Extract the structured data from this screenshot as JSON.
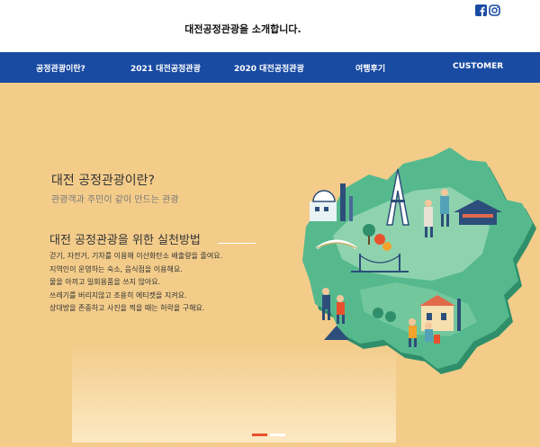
{
  "header": {
    "site_title": "대전공정관광을 소개합니다.",
    "social_icons": [
      "facebook-icon",
      "instagram-icon"
    ],
    "brand_color": "#1a4ba3"
  },
  "nav": {
    "items": [
      {
        "label": "공정관광이란?"
      },
      {
        "label": "2021 대전공정관광"
      },
      {
        "label": "2020 대전공정관광"
      },
      {
        "label": "여행후기"
      },
      {
        "label": "CUSTOMER"
      }
    ]
  },
  "hero": {
    "background_color": "#f3cc8a",
    "title": "대전 공정관광이란?",
    "subtitle": "관광객과 주민이 같이 만드는 관광",
    "method_title": "대전 공정관광을 위한 실천방법",
    "practices": [
      "걷기, 자전거, 기차를 이용해 이산화탄소 배출량을 줄여요.",
      "지역인이 운영하는 숙소, 음식점을 이용해요.",
      "물을 아끼고 일회용품을 쓰지 않아요.",
      "쓰레기를 버리지않고 조용히 에티켓을 지켜요.",
      "상대방을 존중하고 사진을 찍을 때는 허락을 구해요."
    ],
    "illustration": "daejeon-map-illustration"
  },
  "slider": {
    "slide_count": 2,
    "active_index": 0,
    "active_color": "#e8512c"
  }
}
